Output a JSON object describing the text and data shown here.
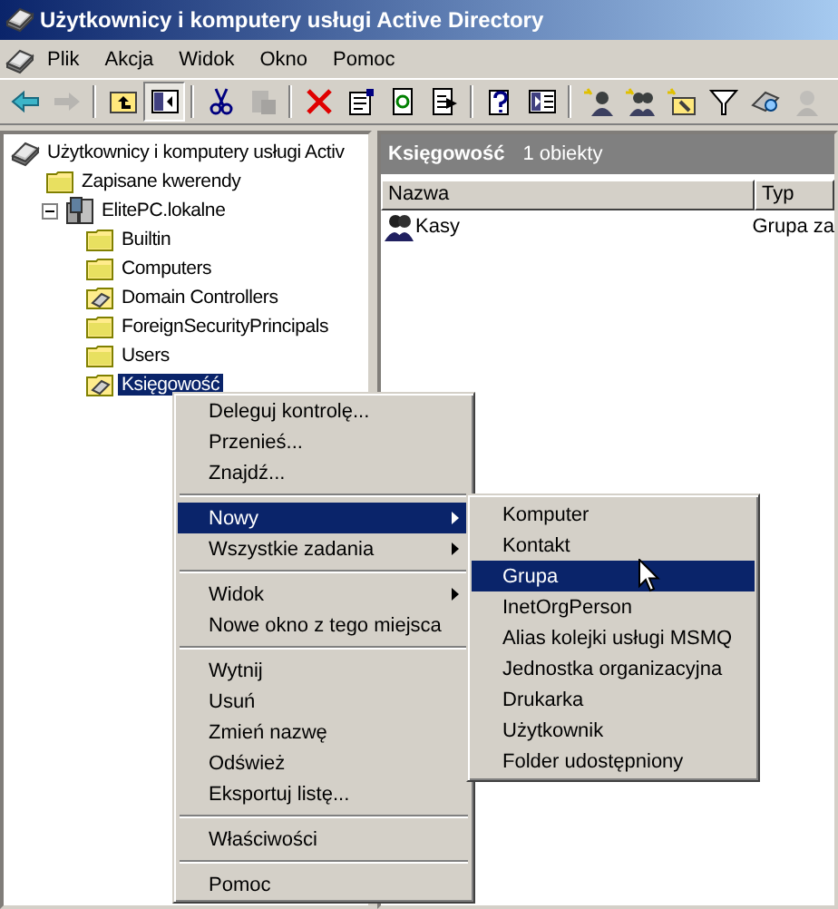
{
  "window": {
    "title": "Użytkownicy i komputery usługi Active Directory"
  },
  "menu_bar": [
    "Plik",
    "Akcja",
    "Widok",
    "Okno",
    "Pomoc"
  ],
  "toolbar": [
    {
      "kind": "back",
      "disabled": false,
      "pressed": false
    },
    {
      "kind": "forward",
      "disabled": true,
      "pressed": false
    },
    {
      "kind": "separator"
    },
    {
      "kind": "up",
      "disabled": false,
      "pressed": false
    },
    {
      "kind": "tree",
      "disabled": false,
      "pressed": true
    },
    {
      "kind": "separator"
    },
    {
      "kind": "cut",
      "disabled": false,
      "pressed": false
    },
    {
      "kind": "paste",
      "disabled": true,
      "pressed": false
    },
    {
      "kind": "separator"
    },
    {
      "kind": "delete",
      "disabled": false,
      "pressed": false
    },
    {
      "kind": "properties",
      "disabled": false,
      "pressed": false
    },
    {
      "kind": "refresh",
      "disabled": false,
      "pressed": false
    },
    {
      "kind": "export",
      "disabled": false,
      "pressed": false
    },
    {
      "kind": "separator"
    },
    {
      "kind": "help",
      "disabled": false,
      "pressed": false
    },
    {
      "kind": "pane",
      "disabled": false,
      "pressed": false
    },
    {
      "kind": "separator"
    },
    {
      "kind": "new-user",
      "disabled": false,
      "pressed": false
    },
    {
      "kind": "new-group",
      "disabled": false,
      "pressed": false
    },
    {
      "kind": "new-ou",
      "disabled": false,
      "pressed": false
    },
    {
      "kind": "filter",
      "disabled": false,
      "pressed": false
    },
    {
      "kind": "find",
      "disabled": false,
      "pressed": false
    },
    {
      "kind": "add-group",
      "disabled": true,
      "pressed": false
    }
  ],
  "tree": [
    {
      "label": "Użytkownicy i komputery usługi Activ",
      "kind": "console",
      "selected": false,
      "children": [
        {
          "label": "Zapisane kwerendy",
          "kind": "folder",
          "selected": false
        },
        {
          "label": "ElitePC.lokalne",
          "kind": "domain",
          "selected": false,
          "expanded": true,
          "children": [
            {
              "label": "Builtin",
              "kind": "folder",
              "selected": false
            },
            {
              "label": "Computers",
              "kind": "folder",
              "selected": false
            },
            {
              "label": "Domain Controllers",
              "kind": "ou",
              "selected": false
            },
            {
              "label": "ForeignSecurityPrincipals",
              "kind": "folder",
              "selected": false
            },
            {
              "label": "Users",
              "kind": "folder",
              "selected": false
            },
            {
              "label": "Księgowość",
              "kind": "ou",
              "selected": true
            }
          ]
        }
      ]
    }
  ],
  "details": {
    "title": "Księgowość",
    "count": "1 obiekty",
    "columns": [
      "Nazwa",
      "Typ"
    ],
    "rows": [
      {
        "name": "Kasy",
        "type": "Grupa za"
      }
    ]
  },
  "context_menu": [
    {
      "kind": "item",
      "label": "Deleguj kontrolę...",
      "submenu": false,
      "selected": false
    },
    {
      "kind": "item",
      "label": "Przenieś...",
      "submenu": false,
      "selected": false
    },
    {
      "kind": "item",
      "label": "Znajdź...",
      "submenu": false,
      "selected": false
    },
    {
      "kind": "separator"
    },
    {
      "kind": "item",
      "label": "Nowy",
      "submenu": true,
      "selected": true
    },
    {
      "kind": "item",
      "label": "Wszystkie zadania",
      "submenu": true,
      "selected": false
    },
    {
      "kind": "separator"
    },
    {
      "kind": "item",
      "label": "Widok",
      "submenu": true,
      "selected": false
    },
    {
      "kind": "item",
      "label": "Nowe okno z tego miejsca",
      "submenu": false,
      "selected": false
    },
    {
      "kind": "separator"
    },
    {
      "kind": "item",
      "label": "Wytnij",
      "submenu": false,
      "selected": false
    },
    {
      "kind": "item",
      "label": "Usuń",
      "submenu": false,
      "selected": false
    },
    {
      "kind": "item",
      "label": "Zmień nazwę",
      "submenu": false,
      "selected": false
    },
    {
      "kind": "item",
      "label": "Odśwież",
      "submenu": false,
      "selected": false
    },
    {
      "kind": "item",
      "label": "Eksportuj listę...",
      "submenu": false,
      "selected": false
    },
    {
      "kind": "separator"
    },
    {
      "kind": "item",
      "label": "Właściwości",
      "submenu": false,
      "selected": false
    },
    {
      "kind": "separator"
    },
    {
      "kind": "item",
      "label": "Pomoc",
      "submenu": false,
      "selected": false
    }
  ],
  "submenu": [
    {
      "label": "Komputer",
      "selected": false
    },
    {
      "label": "Kontakt",
      "selected": false
    },
    {
      "label": "Grupa",
      "selected": true
    },
    {
      "label": "InetOrgPerson",
      "selected": false
    },
    {
      "label": "Alias kolejki usługi MSMQ",
      "selected": false
    },
    {
      "label": "Jednostka organizacyjna",
      "selected": false
    },
    {
      "label": "Drukarka",
      "selected": false
    },
    {
      "label": "Użytkownik",
      "selected": false
    },
    {
      "label": "Folder udostępniony",
      "selected": false
    }
  ]
}
